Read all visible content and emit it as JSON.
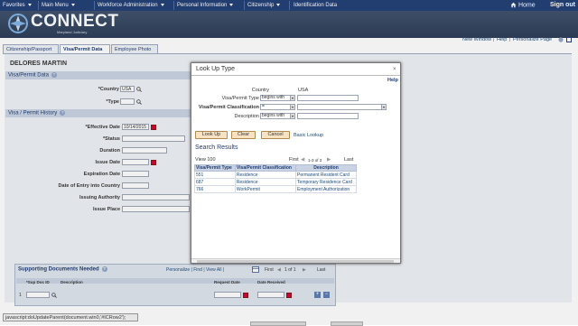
{
  "topbar": {
    "menus": [
      "Favorites",
      "Main Menu",
      "Workforce Administration",
      "Personal Information",
      "Citizenship",
      "Identification Data"
    ],
    "home": "Home",
    "signout": "Sign out"
  },
  "banner": {
    "logo": "CONNECT",
    "sub": "Maryland Judiciary"
  },
  "utility": {
    "new_window": "New Window",
    "help": "Help",
    "personalize": "Personalize Page"
  },
  "tabs": [
    "Citizenship/Passport",
    "Visa/Permit Data",
    "Employee Photo"
  ],
  "employee_name": "DELORES MARTIN",
  "sections": {
    "visa_permit_data": "Visa/Permit Data",
    "visa_permit_history": "Visa / Permit History"
  },
  "form": {
    "country_label": "*Country",
    "country_value": "USA",
    "type_label": "*Type",
    "effective_date_label": "*Effective Date",
    "effective_date_value": "10/14/2015",
    "status_label": "*Status",
    "duration_label": "Duration",
    "issue_date_label": "Issue Date",
    "expiration_date_label": "Expiration Date",
    "date_entry_label": "Date of Entry into Country",
    "issuing_authority_label": "Issuing Authority",
    "issue_place_label": "Issue Place"
  },
  "docs": {
    "title": "Supporting Documents Needed",
    "nav_links": "Personalize | Find | View All |",
    "first": "First",
    "page": "1 of 1",
    "last": "Last",
    "col_sup_doc_id": "*Sup Doc ID",
    "col_description": "Description",
    "col_request_date": "Request Date",
    "col_date_received": "Date Received",
    "row_num": "1"
  },
  "statusbar": "javascript:doUpdateParent(document.win0,'#ICRow2');",
  "modal": {
    "title": "Look Up Type",
    "close": "×",
    "help": "Help",
    "country_label": "Country",
    "country_value": "USA",
    "visa_type_label": "Visa/Permit Type",
    "visa_type_op": "begins with",
    "classification_label": "Visa/Permit Classification",
    "classification_op": "=",
    "description_label": "Description",
    "description_op": "begins with",
    "btn_lookup": "Look Up",
    "btn_clear": "Clear",
    "btn_cancel": "Cancel",
    "basic_lookup": "Basic Lookup",
    "search_results": "Search Results",
    "view_100": "View 100",
    "first": "First",
    "range": "1-3 of 3",
    "last": "Last",
    "table": {
      "headers": [
        "Visa/Permit Type",
        "Visa/Permit Classification",
        "Description"
      ],
      "rows": [
        [
          "551",
          "Residence",
          "Permanent Resident Card"
        ],
        [
          "687",
          "Residence",
          "Temporary Residence Card"
        ],
        [
          "766",
          "WorkPermit",
          "Employment Authorization"
        ]
      ]
    }
  },
  "colors": {
    "topbar": "#1f3c73",
    "banner": "#2a3a54",
    "section_header": "#c9d3e3",
    "button": "#f7e3c4",
    "link": "#1a4a7a"
  }
}
